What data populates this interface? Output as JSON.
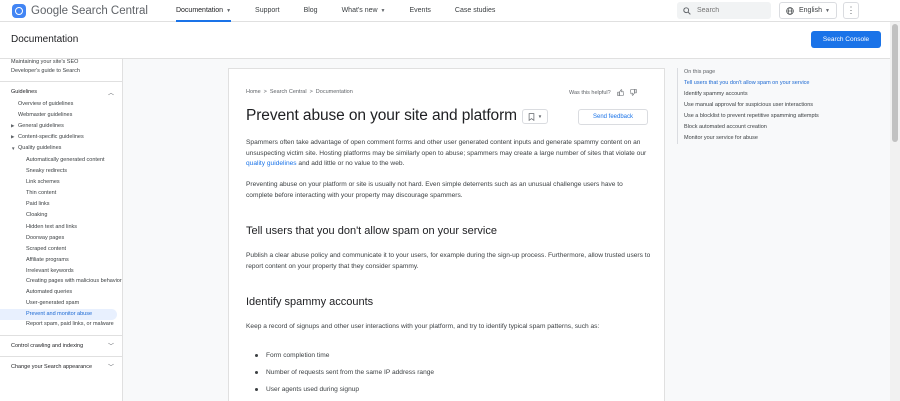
{
  "topbar": {
    "logo_text": "Google Search Central",
    "nav": [
      {
        "label": "Documentation",
        "dropdown": true,
        "active": true
      },
      {
        "label": "Support"
      },
      {
        "label": "Blog"
      },
      {
        "label": "What's new",
        "dropdown": true
      },
      {
        "label": "Events"
      },
      {
        "label": "Case studies"
      }
    ],
    "search_placeholder": "Search",
    "language": "English",
    "more_icon": "more-vert-icon"
  },
  "header": {
    "title": "Documentation",
    "console_button": "Search Console"
  },
  "sidebar": {
    "top_links": [
      "Maintaining your site's SEO",
      "Developer's guide to Search"
    ],
    "section_guidelines": "Guidelines",
    "items": [
      {
        "label": "Overview of guidelines"
      },
      {
        "label": "Webmaster guidelines"
      },
      {
        "label": "General guidelines"
      },
      {
        "label": "Content-specific guidelines"
      },
      {
        "label": "Quality guidelines"
      }
    ],
    "quality_items": [
      "Automatically generated content",
      "Sneaky redirects",
      "Link schemes",
      "Thin content",
      "Paid links",
      "Cloaking",
      "Hidden text and links",
      "Doorway pages",
      "Scraped content",
      "Affiliate programs",
      "Irrelevant keywords",
      "Creating pages with malicious behavior",
      "Automated queries",
      "User-generated spam",
      "Prevent and monitor abuse",
      "Report spam, paid links, or malware"
    ],
    "section_crawling": "Control crawling and indexing",
    "section_appearance": "Change your Search appearance"
  },
  "article": {
    "breadcrumbs": [
      "Home",
      "Search Central",
      "Documentation"
    ],
    "helpful_label": "Was this helpful?",
    "title": "Prevent abuse on your site and platform",
    "send_feedback": "Send feedback",
    "intro_before_link": "Spammers often take advantage of open comment forms and other user generated content inputs and generate spammy content on an unsuspecting victim site. Hosting platforms may be similarly open to abuse; spammers may create a large number of sites that violate our ",
    "intro_link": "quality guidelines",
    "intro_after_link": " and add little or no value to the web.",
    "para2": "Preventing abuse on your platform or site is usually not hard. Even simple deterrents such as an unusual challenge users have to complete before interacting with your property may discourage spammers.",
    "h2_tell": "Tell users that you don't allow spam on your service",
    "para_tell": "Publish a clear abuse policy and communicate it to your users, for example during the sign-up process. Furthermore, allow trusted users to report content on your property that they consider spammy.",
    "h2_identify": "Identify spammy accounts",
    "para_identify": "Keep a record of signups and other user interactions with your platform, and try to identify typical spam patterns, such as:",
    "bullets": [
      "Form completion time",
      "Number of requests sent from the same IP address range",
      "User agents used during signup"
    ]
  },
  "toc": {
    "title": "On this page",
    "items": [
      "Tell users that you don't allow spam on your service",
      "Identify spammy accounts",
      "Use manual approval for suspicious user interactions",
      "Use a blocklist to prevent repetitive spamming attempts",
      "Block automated account creation",
      "Monitor your service for abuse"
    ]
  },
  "colors": {
    "accent": "#1a73e8",
    "active_bg": "#e8f0fe",
    "page_bg": "#f8f9fa"
  }
}
